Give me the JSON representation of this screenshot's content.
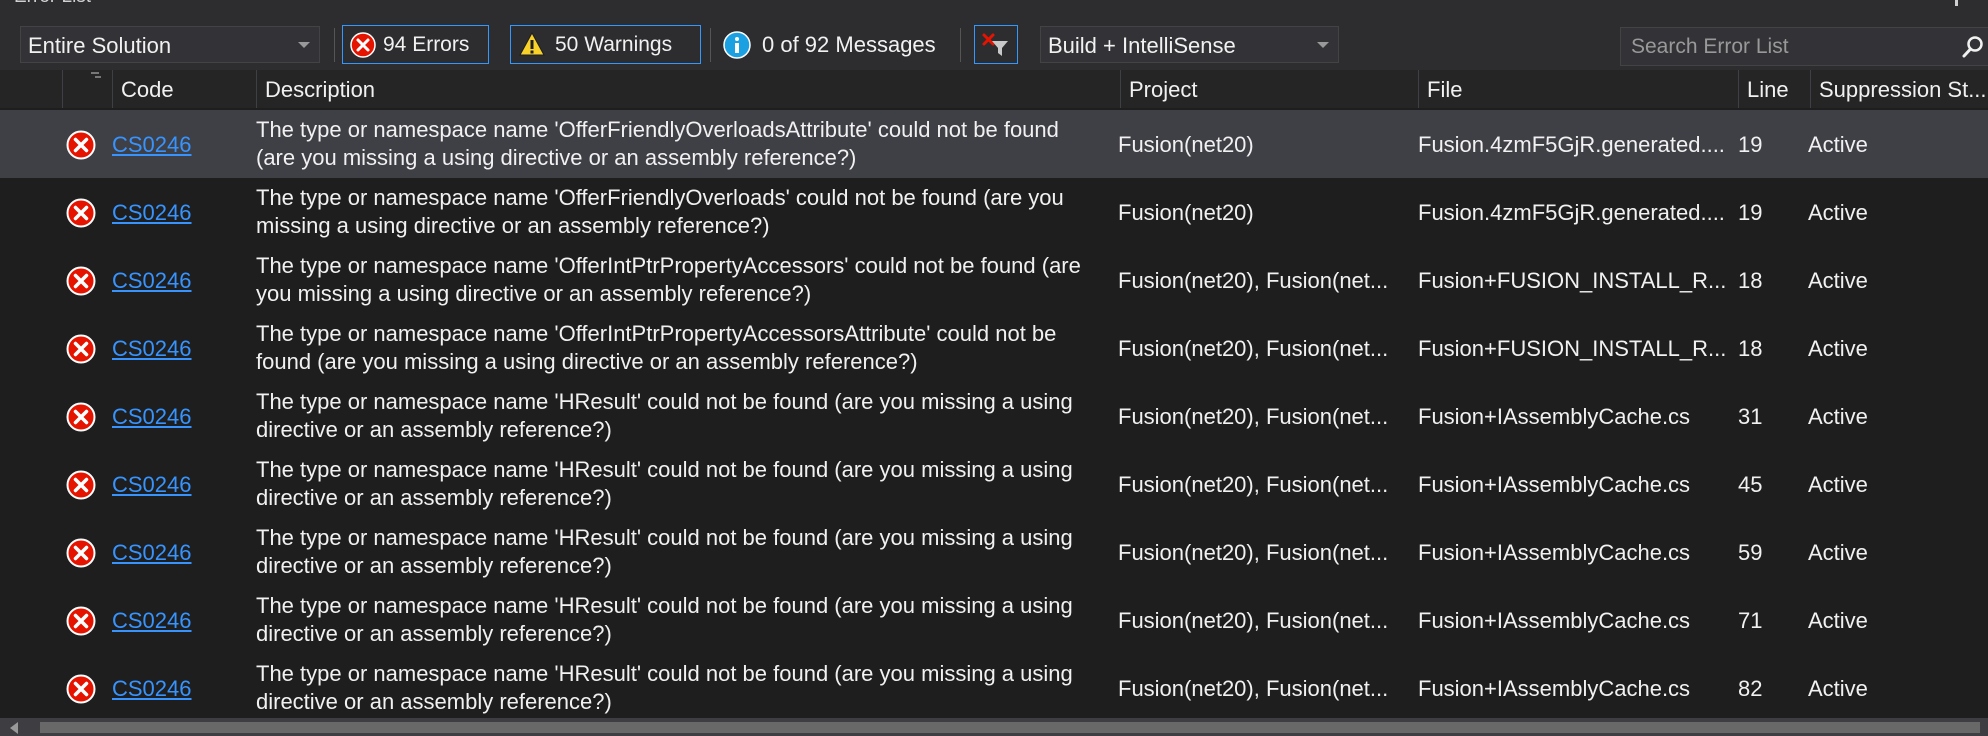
{
  "window": {
    "title": "Error List"
  },
  "toolbar": {
    "scope": "Entire Solution",
    "errors_label": "94 Errors",
    "warnings_label": "50 Warnings",
    "messages_label": "0 of 92 Messages",
    "build_filter": "Build + IntelliSense",
    "search_placeholder": "Search Error List"
  },
  "columns": [
    "Code",
    "Description",
    "Project",
    "File",
    "Line",
    "Suppression St..."
  ],
  "rows": [
    {
      "code": "CS0246",
      "description": "The type or namespace name 'OfferFriendlyOverloadsAttribute' could not be found (are you missing a using directive or an assembly reference?)",
      "project": "Fusion(net20)",
      "file": "Fusion.4zmF5GjR.generated....",
      "line": "19",
      "suppression": "Active",
      "selected": true
    },
    {
      "code": "CS0246",
      "description": "The type or namespace name 'OfferFriendlyOverloads' could not be found (are you missing a using directive or an assembly reference?)",
      "project": "Fusion(net20)",
      "file": "Fusion.4zmF5GjR.generated....",
      "line": "19",
      "suppression": "Active"
    },
    {
      "code": "CS0246",
      "description": "The type or namespace name 'OfferIntPtrPropertyAccessors' could not be found (are you missing a using directive or an assembly reference?)",
      "project": "Fusion(net20), Fusion(net...",
      "file": "Fusion+FUSION_INSTALL_R...",
      "line": "18",
      "suppression": "Active"
    },
    {
      "code": "CS0246",
      "description": "The type or namespace name 'OfferIntPtrPropertyAccessorsAttribute' could not be found (are you missing a using directive or an assembly reference?)",
      "project": "Fusion(net20), Fusion(net...",
      "file": "Fusion+FUSION_INSTALL_R...",
      "line": "18",
      "suppression": "Active"
    },
    {
      "code": "CS0246",
      "description": "The type or namespace name 'HResult' could not be found (are you missing a using directive or an assembly reference?)",
      "project": "Fusion(net20), Fusion(net...",
      "file": "Fusion+IAssemblyCache.cs",
      "line": "31",
      "suppression": "Active"
    },
    {
      "code": "CS0246",
      "description": "The type or namespace name 'HResult' could not be found (are you missing a using directive or an assembly reference?)",
      "project": "Fusion(net20), Fusion(net...",
      "file": "Fusion+IAssemblyCache.cs",
      "line": "45",
      "suppression": "Active"
    },
    {
      "code": "CS0246",
      "description": "The type or namespace name 'HResult' could not be found (are you missing a using directive or an assembly reference?)",
      "project": "Fusion(net20), Fusion(net...",
      "file": "Fusion+IAssemblyCache.cs",
      "line": "59",
      "suppression": "Active"
    },
    {
      "code": "CS0246",
      "description": "The type or namespace name 'HResult' could not be found (are you missing a using directive or an assembly reference?)",
      "project": "Fusion(net20), Fusion(net...",
      "file": "Fusion+IAssemblyCache.cs",
      "line": "71",
      "suppression": "Active"
    },
    {
      "code": "CS0246",
      "description": "The type or namespace name 'HResult' could not be found (are you missing a using directive or an assembly reference?)",
      "project": "Fusion(net20), Fusion(net...",
      "file": "Fusion+IAssemblyCache.cs",
      "line": "82",
      "suppression": "Active"
    }
  ],
  "icons": {
    "error": "error-circle-icon",
    "warning": "warning-triangle-icon",
    "info": "info-circle-icon",
    "clear_filter": "clear-filter-icon",
    "search": "search-icon"
  },
  "colors": {
    "background": "#1e1e1e",
    "selected_row": "#3f3f46",
    "link": "#3794ff",
    "error": "#e51400",
    "warning": "#f8d22a",
    "info": "#1ba1e2",
    "toggle_border": "#3399ff"
  }
}
